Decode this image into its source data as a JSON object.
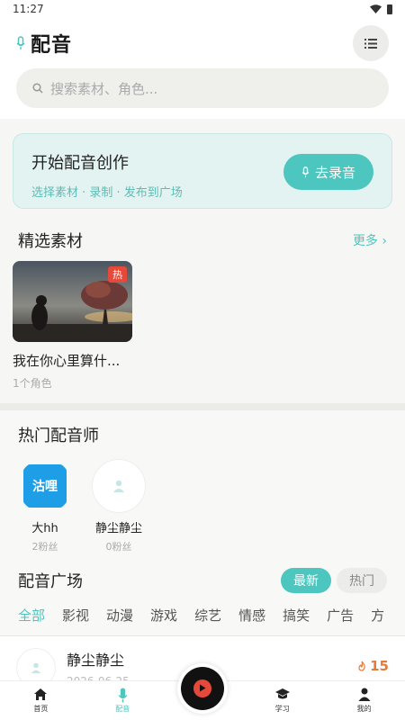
{
  "status": {
    "time": "11:27"
  },
  "header": {
    "title": "配音"
  },
  "search": {
    "placeholder": "搜索素材、角色..."
  },
  "promo": {
    "title": "开始配音创作",
    "subtitle": "选择素材 · 录制 · 发布到广场",
    "button_label": "去录音"
  },
  "featured": {
    "title": "精选素材",
    "more_label": "更多",
    "items": [
      {
        "badge": "热",
        "title": "我在你心里算什...",
        "meta": "1个角色"
      }
    ]
  },
  "artists": {
    "title": "热门配音师",
    "items": [
      {
        "name": "大hh",
        "fans": "2粉丝",
        "avatar_text": "沽哩"
      },
      {
        "name": "静尘静尘",
        "fans": "0粉丝"
      }
    ]
  },
  "plaza": {
    "title": "配音广场",
    "filters": [
      "最新",
      "热门"
    ],
    "active_filter": "最新",
    "tabs": [
      "全部",
      "影视",
      "动漫",
      "游戏",
      "综艺",
      "情感",
      "搞笑",
      "广告",
      "方"
    ],
    "active_tab": "全部",
    "feed": [
      {
        "name": "静尘静尘",
        "date": "2026-06-25",
        "likes": "15"
      }
    ]
  },
  "nav": {
    "items": [
      "首页",
      "配音",
      "学习",
      "我的"
    ],
    "active": "配音"
  },
  "colors": {
    "accent": "#4cc6be",
    "hot": "#e5493a",
    "likes": "#e57b3a"
  }
}
